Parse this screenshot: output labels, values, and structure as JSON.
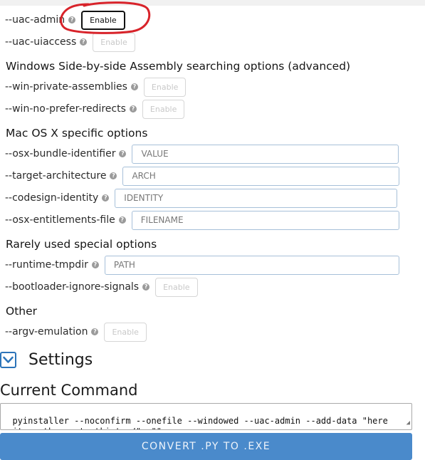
{
  "colors": {
    "accent": "#4a8acb",
    "annotation": "#d8232a"
  },
  "advanced": {
    "uac_admin": {
      "label": "--uac-admin",
      "button": "Enable"
    },
    "uac_uiaccess": {
      "label": "--uac-uiaccess",
      "button": "Enable"
    }
  },
  "windows_sxs": {
    "heading": "Windows Side-by-side Assembly searching options (advanced)",
    "win_private_assemblies": {
      "label": "--win-private-assemblies",
      "button": "Enable"
    },
    "win_no_prefer_redirects": {
      "label": "--win-no-prefer-redirects",
      "button": "Enable"
    }
  },
  "mac": {
    "heading": "Mac OS X specific options",
    "osx_bundle_identifier": {
      "label": "--osx-bundle-identifier",
      "placeholder": "VALUE"
    },
    "target_architecture": {
      "label": "--target-architecture",
      "placeholder": "ARCH"
    },
    "codesign_identity": {
      "label": "--codesign-identity",
      "placeholder": "IDENTITY"
    },
    "osx_entitlements_file": {
      "label": "--osx-entitlements-file",
      "placeholder": "FILENAME"
    }
  },
  "rare": {
    "heading": "Rarely used special options",
    "runtime_tmpdir": {
      "label": "--runtime-tmpdir",
      "placeholder": "PATH"
    },
    "bootloader_ignore_signals": {
      "label": "--bootloader-ignore-signals",
      "button": "Enable"
    }
  },
  "other": {
    "heading": "Other",
    "argv_emulation": {
      "label": "--argv-emulation",
      "button": "Enable"
    }
  },
  "settings": {
    "label": "Settings",
    "icon": "chevron-down-icon"
  },
  "command": {
    "title": "Current Command",
    "text": "pyinstaller --noconfirm --onefile --windowed --uac-admin --add-data \"here write path ;customtkinter/\"  \"\""
  },
  "convert_button": "CONVERT .PY TO .EXE",
  "help_icon": "?"
}
